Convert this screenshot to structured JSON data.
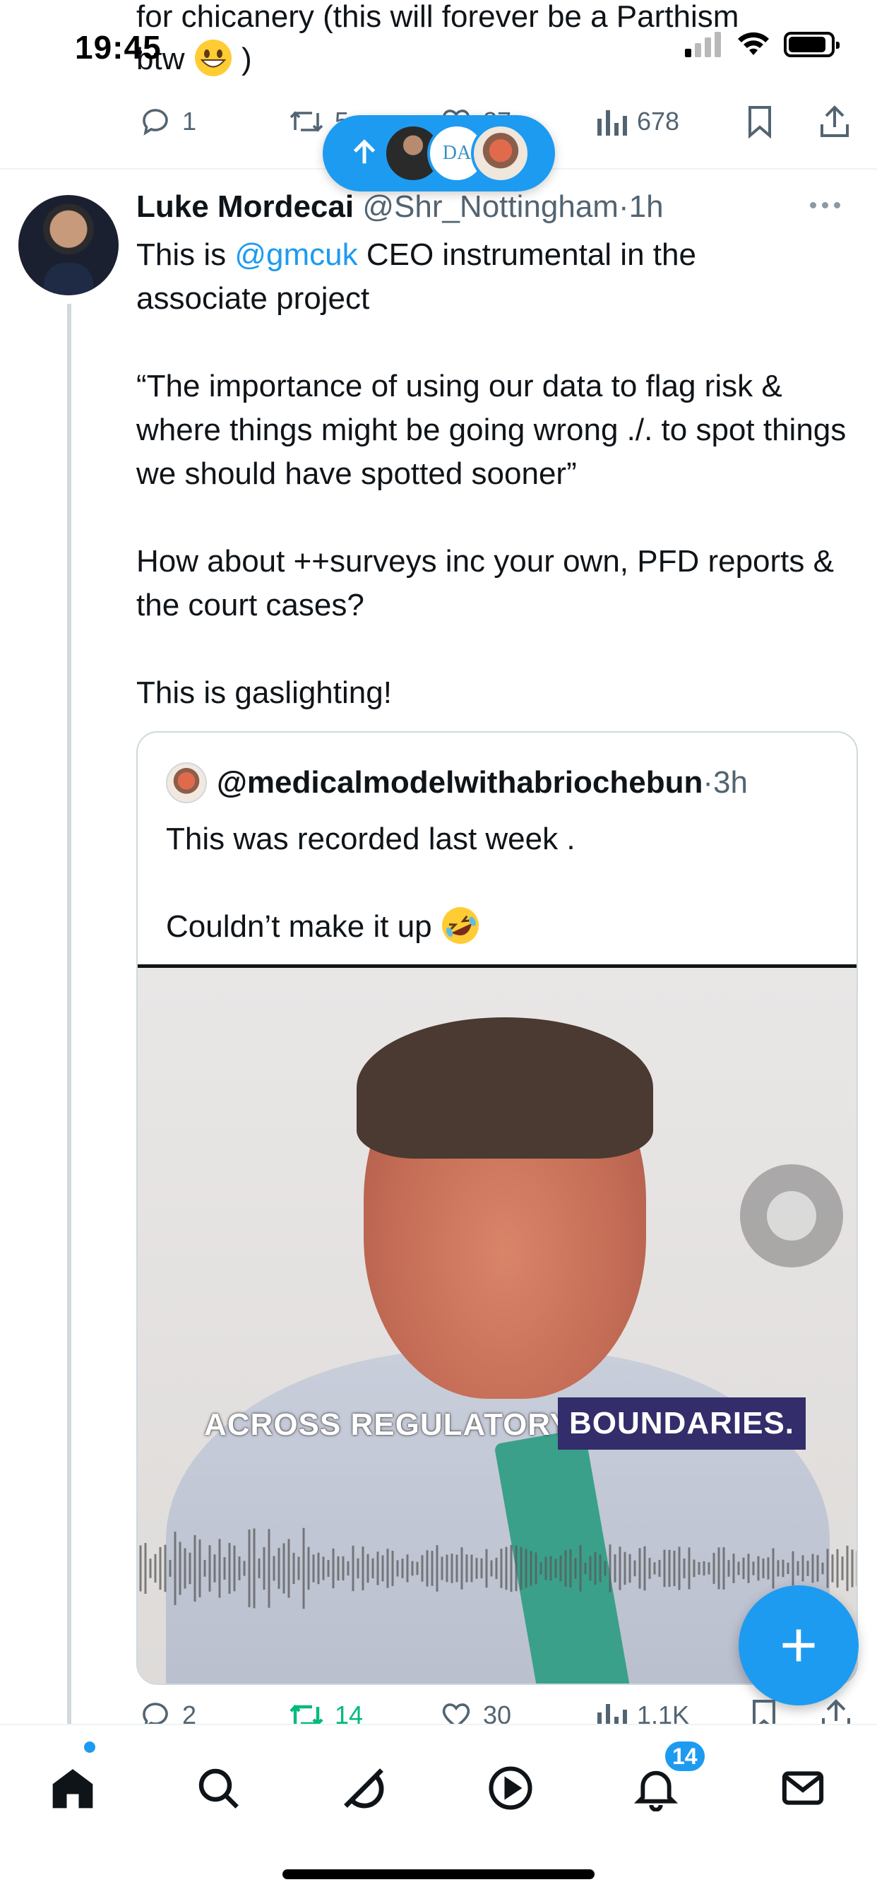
{
  "status_bar": {
    "time": "19:45"
  },
  "previous_post": {
    "text_line1": "for chicanery (this will forever be a Parthism",
    "text_line2_start": "btw",
    "text_line2_end": ")",
    "emoji": "grinning-face",
    "actions": {
      "replies": "1",
      "reposts": "5",
      "likes": "27",
      "views": "678"
    }
  },
  "new_posts_pill": {
    "icon": "arrow-up-icon"
  },
  "post": {
    "author_name": "Luke Mordecai",
    "author_handle": "@Shr_Nottingham",
    "separator": "·",
    "time": "1h",
    "line1_prefix": "This is ",
    "mention": "@gmcuk",
    "line1_suffix": " CEO instrumental in the",
    "line2": "associate project",
    "para2": "“The importance of using our data to flag risk & where things might be going wrong ./. to spot things we should have spotted sooner”",
    "para3": "How about ++surveys inc your own, PFD reports & the court cases?",
    "para4": "This is gaslighting!",
    "actions": {
      "replies": "2",
      "reposts": "14",
      "likes": "30",
      "views": "1.1K"
    }
  },
  "quote": {
    "handle": "@medicalmodelwithabriochebun",
    "separator": "·",
    "time": "3h",
    "line1": "This was recorded last week .",
    "line2": "Couldn’t make it up",
    "emoji": "rolling-on-the-floor-laughing",
    "video_caption_1": "ACROSS REGULATORY",
    "video_caption_2": "BOUNDARIES."
  },
  "colors": {
    "accent": "#1d9bf0",
    "repost_green": "#00ba7c",
    "secondary_text": "#536471"
  },
  "tab_bar": {
    "items": [
      "home-icon",
      "search-icon",
      "grok-icon",
      "video-icon",
      "notifications-icon",
      "messages-icon"
    ],
    "notification_count": "14"
  }
}
